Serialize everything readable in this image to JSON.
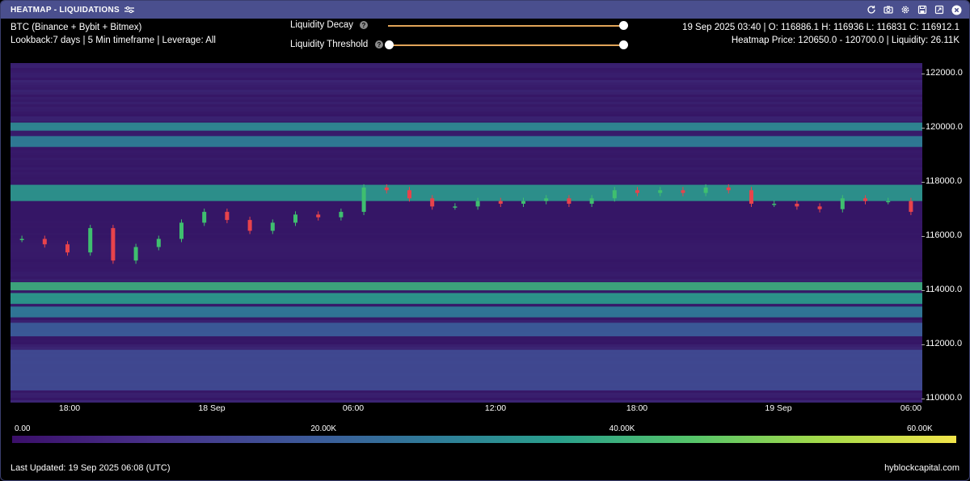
{
  "window": {
    "title": "HEATMAP - LIQUIDATIONS",
    "title_bg": "#4a4f8e",
    "actions": [
      "refresh-icon",
      "camera-icon",
      "gear-icon",
      "save-icon",
      "expand-icon",
      "close-icon"
    ]
  },
  "info": {
    "line1": "BTC (Binance + Bybit + Bitmex)",
    "line2": "Lookback:7 days | 5 Min timeframe | Leverage: All",
    "ohlc": "19 Sep 2025 03:40 | O: 116886.1 H: 116936 L: 116831 C: 116912.1",
    "heatmap_price": "Heatmap Price: 120650.0 - 120700.0 | Liquidity: 26.11K"
  },
  "controls": {
    "decay_label": "Liquidity Decay",
    "threshold_label": "Liquidity Threshold",
    "help_glyph": "?",
    "decay_value": 1.0,
    "threshold_range": [
      0.0,
      1.0
    ],
    "track_color": "#e0a458"
  },
  "chart_data": {
    "type": "heatmap",
    "title": "",
    "xlabel": "",
    "ylabel": "",
    "x_tick_labels": [
      "18:00",
      "18 Sep",
      "06:00",
      "12:00",
      "18:00",
      "19 Sep",
      "06:00"
    ],
    "y_tick_labels": [
      "122000.0",
      "120000.0",
      "118000.0",
      "116000.0",
      "114000.0",
      "112000.0",
      "110000.0"
    ],
    "ylim": [
      109850,
      122400
    ],
    "colorbar": {
      "min": 0,
      "max": 60000,
      "tick_labels": [
        "0.00",
        "20.00K",
        "40.00K",
        "60.00K"
      ],
      "colors": [
        "#3b0f6a",
        "#48318a",
        "#3c5b9a",
        "#2f7d99",
        "#2aa08c",
        "#55c46a",
        "#a6db4a",
        "#f2e44a"
      ]
    },
    "liquidity_bands": [
      {
        "low": 119900,
        "high": 120200,
        "value": 30000
      },
      {
        "low": 119300,
        "high": 119700,
        "value": 27000
      },
      {
        "low": 117300,
        "high": 117900,
        "value": 33000
      },
      {
        "low": 114000,
        "high": 114300,
        "value": 38000
      },
      {
        "low": 113500,
        "high": 113900,
        "value": 34000
      },
      {
        "low": 113000,
        "high": 113400,
        "value": 26000
      },
      {
        "low": 112300,
        "high": 112800,
        "value": 18000
      },
      {
        "low": 110300,
        "high": 111800,
        "value": 14000
      }
    ],
    "price_series": {
      "name": "",
      "up_color": "#3fbf6f",
      "down_color": "#e8434b",
      "values": [
        115900,
        115700,
        115400,
        116300,
        115100,
        115600,
        115900,
        116500,
        116900,
        116600,
        116200,
        116500,
        116800,
        116700,
        116900,
        117800,
        117700,
        117400,
        117100,
        117100,
        117300,
        117200,
        117300,
        117400,
        117200,
        117400,
        117700,
        117600,
        117700,
        117600,
        117800,
        117700,
        117200,
        117200,
        117100,
        117000,
        117400,
        117300,
        117300,
        116900
      ]
    }
  },
  "footer": {
    "last_updated": "Last Updated: 19 Sep 2025 06:08 (UTC)",
    "brand": "hyblockcapital.com"
  }
}
